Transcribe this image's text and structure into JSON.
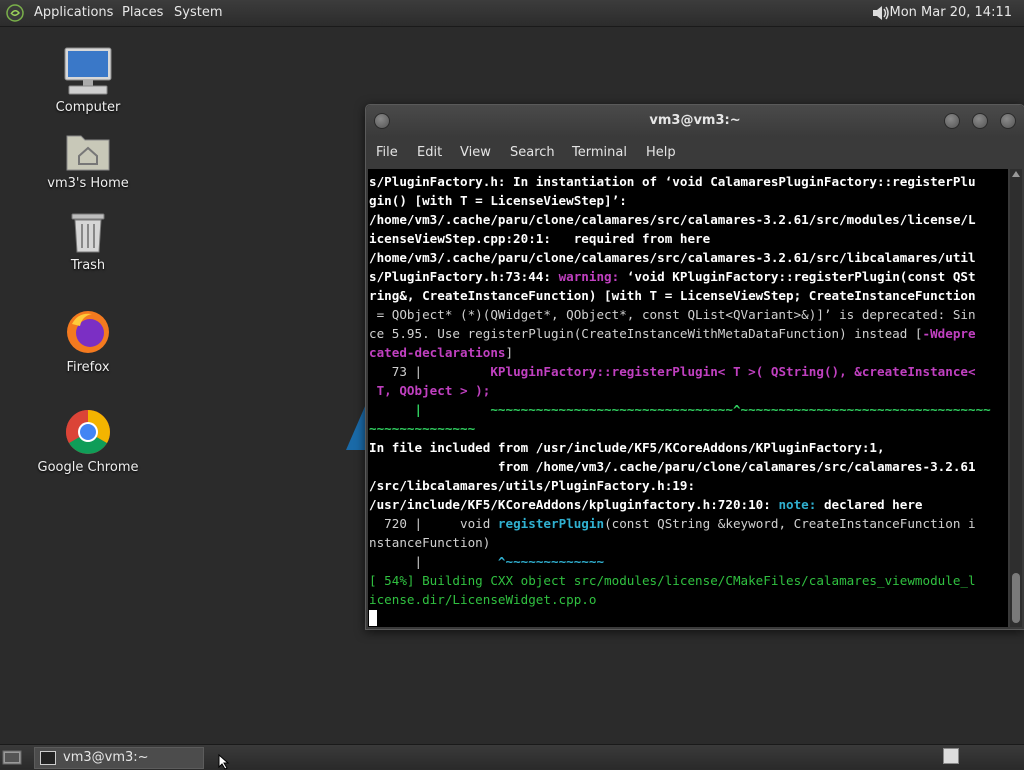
{
  "top_panel": {
    "menus": [
      "Applications",
      "Places",
      "System"
    ],
    "datetime": "Mon Mar 20, 14:11"
  },
  "desktop": {
    "icons": [
      {
        "label": "Computer",
        "icon": "computer-icon"
      },
      {
        "label": "vm3's Home",
        "icon": "home-folder-icon"
      },
      {
        "label": "Trash",
        "icon": "trash-icon"
      },
      {
        "label": "Firefox",
        "icon": "firefox-icon"
      },
      {
        "label": "Google Chrome",
        "icon": "chrome-icon"
      }
    ]
  },
  "terminal": {
    "title": "vm3@vm3:~",
    "menu": [
      "File",
      "Edit",
      "View",
      "Search",
      "Terminal",
      "Help"
    ],
    "lines": [
      "s/PluginFactory.h: In instantiation of ‘void CalamaresPluginFactory::registerPlu",
      "gin() [with T = LicenseViewStep]’:",
      "/home/vm3/.cache/paru/clone/calamares/src/calamares-3.2.61/src/modules/license/L",
      "icenseViewStep.cpp:20:1:   required from here",
      "/home/vm3/.cache/paru/clone/calamares/src/calamares-3.2.61/src/libcalamares/util",
      "s/PluginFactory.h:73:44: warning: ‘void KPluginFactory::registerPlugin(const QSt",
      "ring&, CreateInstanceFunction) [with T = LicenseViewStep; CreateInstanceFunction",
      " = QObject* (*)(QWidget*, QObject*, const QList<QVariant>&)]’ is deprecated: Sin",
      "ce 5.95. Use registerPlugin(CreateInstanceWithMetaDataFunction) instead [-Wdepre",
      "cated-declarations]",
      "   73 |         KPluginFactory::registerPlugin< T >( QString(), &createInstance<",
      " T, QObject > );",
      "      |         ~~~~~~~~~~~~~~~~~~~~~~~~~~~~~~~~^~~~~~~~~~~~~~~~~~~~~~~~~~~~~~~~~~",
      "~~~~~~~~~~~~~~",
      "In file included from /usr/include/KF5/KCoreAddons/KPluginFactory:1,",
      "                 from /home/vm3/.cache/paru/clone/calamares/src/calamares-3.2.61",
      "/src/libcalamares/utils/PluginFactory.h:19:",
      "/usr/include/KF5/KCoreAddons/kpluginfactory.h:720:10: note: declared here",
      "  720 |     void registerPlugin(const QString &keyword, CreateInstanceFunction i",
      "nstanceFunction)",
      "      |          ^~~~~~~~~~~~~~",
      "[ 54%] Building CXX object src/modules/license/CMakeFiles/calamares_viewmodule_l",
      "icense.dir/LicenseWidget.cpp.o"
    ]
  },
  "taskbar": {
    "task_label": "vm3@vm3:~"
  },
  "colors": {
    "warning": "#c040c0",
    "note": "#30b0d0",
    "build": "#30c040"
  }
}
